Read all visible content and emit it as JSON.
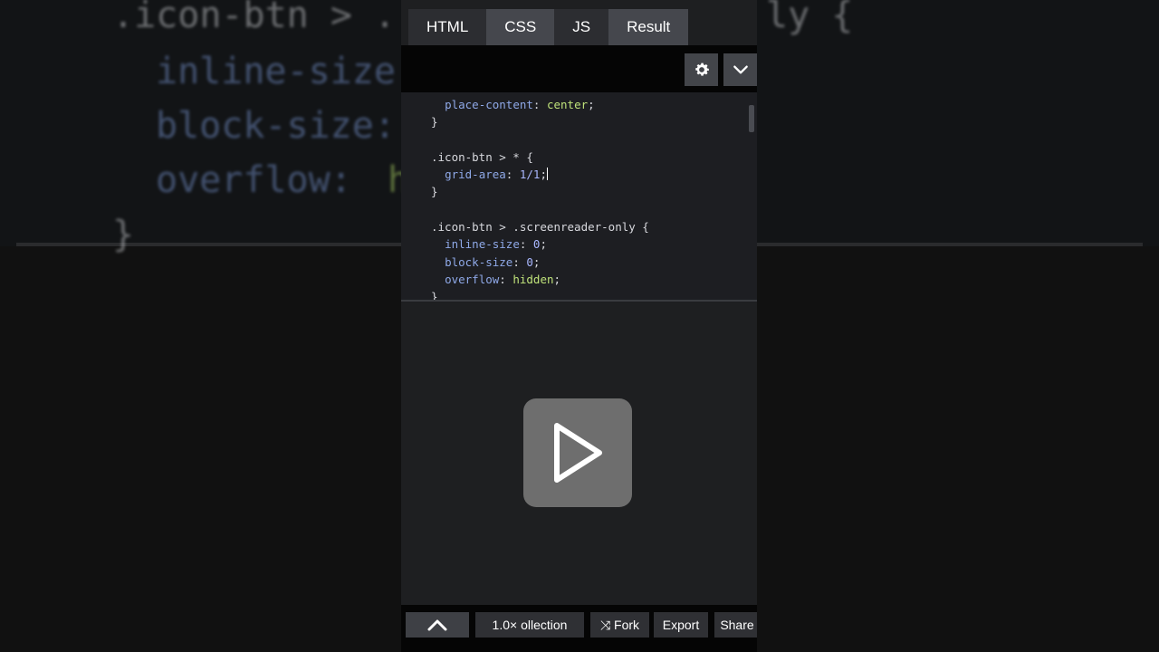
{
  "background": {
    "line1_left": ".icon-btn > .",
    "line1_right": "ly {",
    "line2": "inline-size",
    "line3": "block-size:",
    "line4_prop": "overflow: ",
    "line4_val": "h",
    "line5": "}"
  },
  "tabs": [
    {
      "label": "HTML",
      "active": false
    },
    {
      "label": "CSS",
      "active": true
    },
    {
      "label": "JS",
      "active": false
    },
    {
      "label": "Result",
      "active": true
    }
  ],
  "toolbar": {
    "settings_icon": "gear-icon",
    "collapse_icon": "chevron-down-icon"
  },
  "code": {
    "l1_prop": "place-content",
    "l1_val": "center",
    "l2": "}",
    "l4_sel": ".icon-btn > * {",
    "l5_prop": "grid-area",
    "l5_val": "1/1",
    "l6": "}",
    "l8_sel": ".icon-btn > .screenreader-only {",
    "l9_prop": "inline-size",
    "l9_val": "0",
    "l10_prop": "block-size",
    "l10_val": "0",
    "l11_prop": "overflow",
    "l11_val": "hidden",
    "l12": "}"
  },
  "result": {
    "play_icon": "play-icon"
  },
  "bottom_bar": {
    "up_icon": "chevron-up-icon",
    "speed_collection": "1.0×   ollection",
    "fork": "Fork",
    "export": "Export",
    "share": "Share"
  },
  "colors": {
    "property": "#8fa9e8",
    "value": "#bfe27a",
    "active_tab": "#45474d"
  }
}
